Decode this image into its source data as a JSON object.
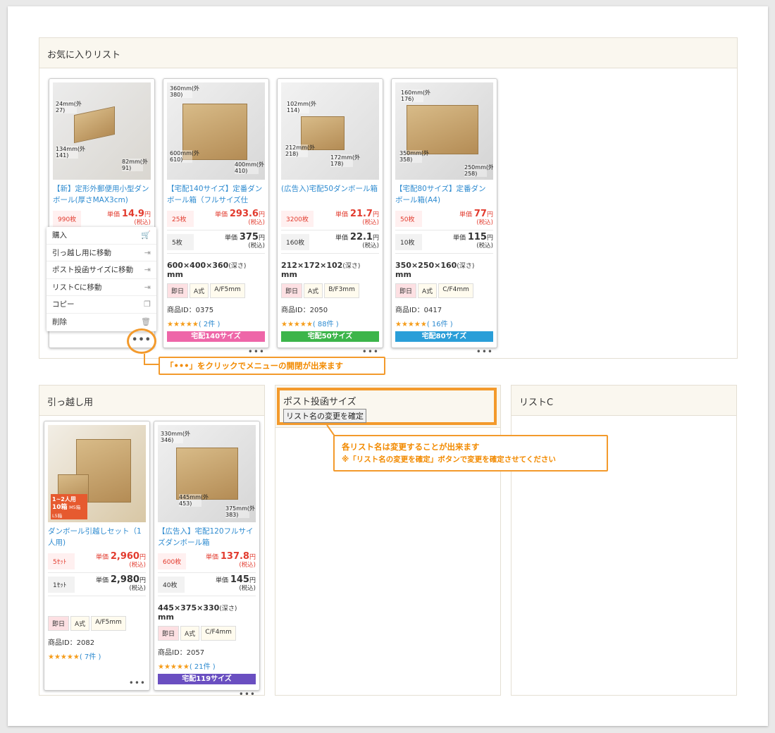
{
  "favorites": {
    "title": "お気に入りリスト",
    "cards": [
      {
        "title": "【新】定形外郵便用小型ダンボール(厚さMAX3cm)",
        "dims_img": [
          "24mm(外27)",
          "134mm(外141)",
          "82mm(外91)"
        ],
        "prices": [
          {
            "qty": "990枚",
            "label": "単価",
            "price": "14.9",
            "yen": "円",
            "tax": "(税込)"
          }
        ]
      },
      {
        "title": "【宅配140サイズ】定番ダンボール箱（フルサイズ仕",
        "dims_img": [
          "360mm(外380)",
          "600mm(外610)",
          "400mm(外410)"
        ],
        "prices": [
          {
            "qty": "25枚",
            "label": "単価",
            "price": "293.6",
            "yen": "円",
            "tax": "(税込)"
          },
          {
            "qty": "5枚",
            "label": "単価",
            "price": "375",
            "yen": "円",
            "tax": "(税込)"
          }
        ],
        "size": "600×400×360",
        "deep": "(深さ)",
        "unit": "mm",
        "tags": [
          "即日",
          "A式",
          "A/F5mm"
        ],
        "pid": "商品ID：0375",
        "stars": "★★★★★",
        "reviews": "( 2件 )",
        "band": "宅配140サイズ",
        "band_color": "#ee66a8"
      },
      {
        "title": "(広告入)宅配50ダンボール箱",
        "dims_img": [
          "102mm(外114)",
          "212mm(外218)",
          "172mm(外178)"
        ],
        "prices": [
          {
            "qty": "3200枚",
            "label": "単価",
            "price": "21.7",
            "yen": "円",
            "tax": "(税込)"
          },
          {
            "qty": "160枚",
            "label": "単価",
            "price": "22.1",
            "yen": "円",
            "tax": "(税込)"
          }
        ],
        "size": "212×172×102",
        "deep": "(深さ)",
        "unit": "mm",
        "tags": [
          "即日",
          "A式",
          "B/F3mm"
        ],
        "pid": "商品ID：2050",
        "stars": "★★★★★",
        "reviews": "( 88件 )",
        "band": "宅配50サイズ",
        "band_color": "#3cb54a"
      },
      {
        "title": "【宅配80サイズ】定番ダンボール箱(A4)",
        "dims_img": [
          "160mm(外176)",
          "350mm(外358)",
          "250mm(外258)"
        ],
        "prices": [
          {
            "qty": "50枚",
            "label": "単価",
            "price": "77",
            "yen": "円",
            "tax": "(税込)"
          },
          {
            "qty": "10枚",
            "label": "単価",
            "price": "115",
            "yen": "円",
            "tax": "(税込)"
          }
        ],
        "size": "350×250×160",
        "deep": "(深さ)",
        "unit": "mm",
        "tags": [
          "即日",
          "A式",
          "C/F4mm"
        ],
        "pid": "商品ID：0417",
        "stars": "★★★★★",
        "reviews": "( 16件 )",
        "band": "宅配80サイズ",
        "band_color": "#2a9ed8"
      }
    ]
  },
  "menu": {
    "items": [
      {
        "label": "購入",
        "icon": "🛒"
      },
      {
        "label": "引っ越し用に移動",
        "icon": "⇥"
      },
      {
        "label": "ポスト投函サイズに移動",
        "icon": "⇥"
      },
      {
        "label": "リストCに移動",
        "icon": "⇥"
      },
      {
        "label": "コピー",
        "icon": "❐"
      },
      {
        "label": "削除",
        "icon": "🗑"
      }
    ]
  },
  "dots": "•••",
  "callout1": "「•••」をクリックでメニューの開閉が出来ます",
  "moving": {
    "title": "引っ越し用",
    "cards": [
      {
        "title": "ダンボール引越しセット（1人用)",
        "badge": "1~2人用",
        "badge2": "10箱",
        "badge3": "M5箱 L5箱",
        "prices": [
          {
            "qty": "5ｾｯﾄ",
            "label": "単価",
            "price": "2,960",
            "yen": "円",
            "tax": "(税込)"
          },
          {
            "qty": "1ｾｯﾄ",
            "label": "単価",
            "price": "2,980",
            "yen": "円",
            "tax": "(税込)"
          }
        ],
        "tags": [
          "即日",
          "A式",
          "A/F5mm"
        ],
        "pid": "商品ID：2082",
        "stars": "★★★★★",
        "reviews": "( 7件 )"
      },
      {
        "title": "【広告入】宅配120フルサイズダンボール箱",
        "dims_img": [
          "330mm(外346)",
          "445mm(外453)",
          "375mm(外383)"
        ],
        "prices": [
          {
            "qty": "600枚",
            "label": "単価",
            "price": "137.8",
            "yen": "円",
            "tax": "(税込)"
          },
          {
            "qty": "40枚",
            "label": "単価",
            "price": "145",
            "yen": "円",
            "tax": "(税込)"
          }
        ],
        "size": "445×375×330",
        "deep": "(深さ)",
        "unit": "mm",
        "tags": [
          "即日",
          "A式",
          "C/F4mm"
        ],
        "pid": "商品ID：2057",
        "stars": "★★★★★",
        "reviews": "( 21件 )",
        "band": "宅配119サイズ",
        "band_color": "#6a4fc1"
      }
    ]
  },
  "post": {
    "title": "ポスト投函サイズ",
    "rename_button": "リスト名の変更を確定"
  },
  "listc": {
    "title": "リストC"
  },
  "callout2": {
    "line1": "各リスト名は変更することが出来ます",
    "line2": "※「リスト名の変更を確定」ボタンで変更を確定させてください"
  }
}
